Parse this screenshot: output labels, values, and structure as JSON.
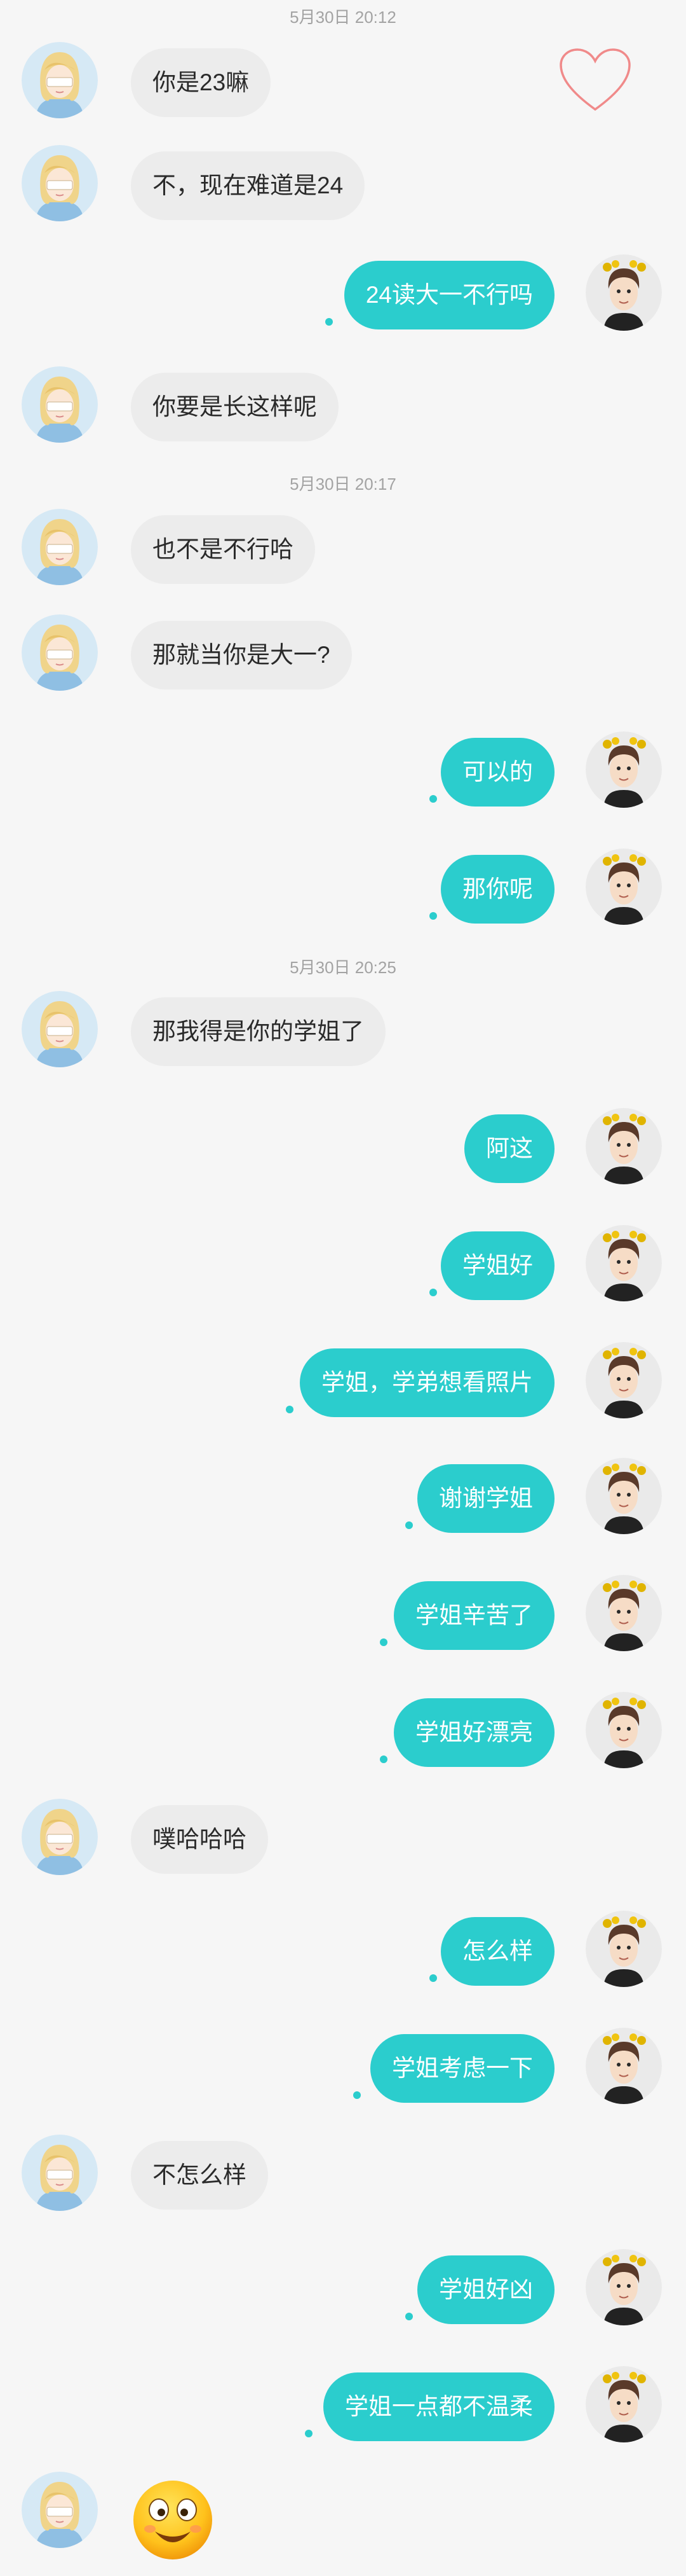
{
  "timestamps": [
    "5月30日 20:12",
    "5月30日 20:17",
    "5月30日 20:25"
  ],
  "messages": [
    {
      "side": "left",
      "text": "你是23嘛"
    },
    {
      "side": "left",
      "text": "不，现在难道是24"
    },
    {
      "side": "right",
      "text": "24读大一不行吗"
    },
    {
      "side": "left",
      "text": "你要是长这样呢"
    },
    {
      "side": "left",
      "text": "也不是不行哈"
    },
    {
      "side": "left",
      "text": "那就当你是大一?"
    },
    {
      "side": "right",
      "text": "可以的"
    },
    {
      "side": "right",
      "text": "那你呢"
    },
    {
      "side": "left",
      "text": "那我得是你的学姐了"
    },
    {
      "side": "right",
      "text": "阿这"
    },
    {
      "side": "right",
      "text": "学姐好"
    },
    {
      "side": "right",
      "text": "学姐，学弟想看照片"
    },
    {
      "side": "right",
      "text": "谢谢学姐"
    },
    {
      "side": "right",
      "text": "学姐辛苦了"
    },
    {
      "side": "right",
      "text": "学姐好漂亮"
    },
    {
      "side": "left",
      "text": "噗哈哈哈"
    },
    {
      "side": "right",
      "text": "怎么样"
    },
    {
      "side": "right",
      "text": "学姐考虑一下"
    },
    {
      "side": "left",
      "text": "不怎么样"
    },
    {
      "side": "right",
      "text": "学姐好凶"
    },
    {
      "side": "right",
      "text": "学姐一点都不温柔"
    },
    {
      "side": "left",
      "type": "emoji",
      "icon": "smiling-emoji-icon"
    }
  ],
  "overlay": {
    "icon": "heart-outline-icon",
    "color": "#f08a8a"
  },
  "colors": {
    "sent_bubble": "#2bcdcd",
    "received_bubble": "#ececec",
    "background": "#f6f6f6"
  }
}
